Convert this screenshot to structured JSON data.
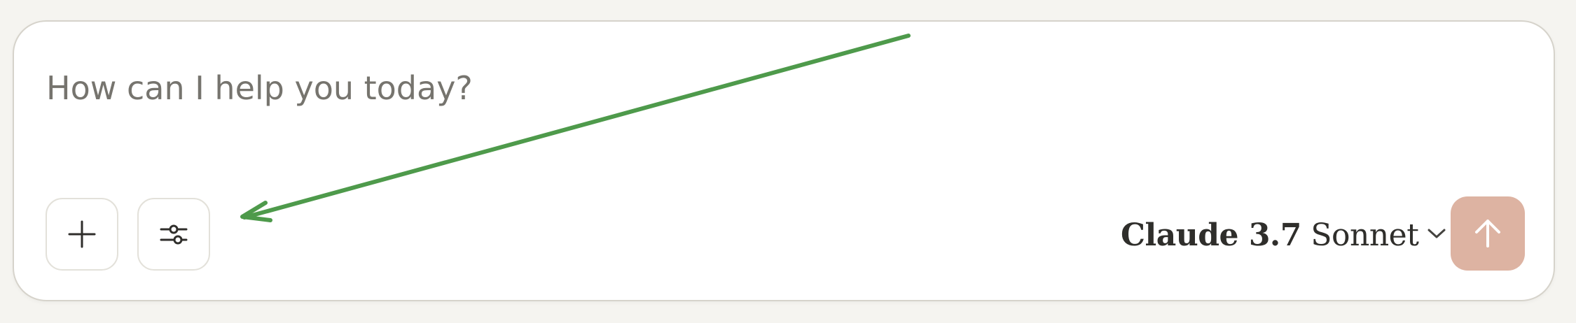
{
  "composer": {
    "placeholder": "How can I help you today?",
    "value": ""
  },
  "toolbar": {
    "add_icon": "plus-icon",
    "settings_icon": "sliders-icon"
  },
  "model_selector": {
    "brand": "Claude 3.7",
    "variant": "Sonnet",
    "icon": "chevron-down-icon"
  },
  "send_button": {
    "icon": "arrow-up-icon",
    "color": "#ddb3a2"
  },
  "annotation": {
    "type": "arrow",
    "color": "#4e9a4b"
  }
}
